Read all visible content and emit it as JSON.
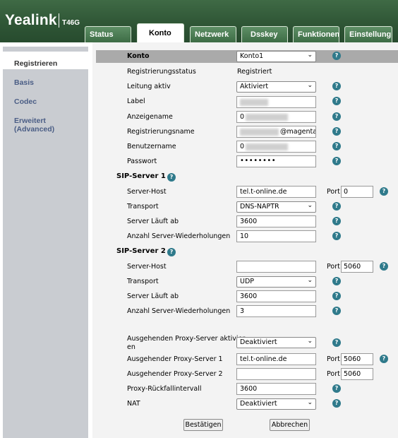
{
  "brand": {
    "logo": "Yealink",
    "model": "T46G"
  },
  "tabs": [
    {
      "label": "Status"
    },
    {
      "label": "Konto"
    },
    {
      "label": "Netzwerk"
    },
    {
      "label": "Dsskey"
    },
    {
      "label": "Funktionen"
    },
    {
      "label": "Einstellung"
    }
  ],
  "sidebar": {
    "items": [
      {
        "label": "Registrieren"
      },
      {
        "label": "Basis"
      },
      {
        "label": "Codec"
      },
      {
        "label": "Erweitert"
      },
      {
        "label": "(Advanced)"
      }
    ]
  },
  "account": {
    "header_label": "Konto",
    "header_value": "Konto1",
    "reg_status_label": "Registrierungsstatus",
    "reg_status_value": "Registriert",
    "line_active_label": "Leitung aktiv",
    "line_active_value": "Aktiviert",
    "label_label": "Label",
    "display_name_label": "Anzeigename",
    "display_name_value": "0",
    "register_name_label": "Registrierungsname",
    "register_name_value": "@magenta",
    "username_label": "Benutzername",
    "username_value": "0",
    "password_label": "Passwort",
    "password_value": "••••••••"
  },
  "sip1": {
    "title": "SIP-Server 1",
    "host_label": "Server-Host",
    "host_value": "tel.t-online.de",
    "port_label": "Port",
    "port_value": "0",
    "transport_label": "Transport",
    "transport_value": "DNS-NAPTR",
    "expires_label": "Server Läuft ab",
    "expires_value": "3600",
    "retry_label": "Anzahl Server-Wiederholungen",
    "retry_value": "10"
  },
  "sip2": {
    "title": "SIP-Server 2",
    "host_label": "Server-Host",
    "host_value": "",
    "port_label": "Port",
    "port_value": "5060",
    "transport_label": "Transport",
    "transport_value": "UDP",
    "expires_label": "Server Läuft ab",
    "expires_value": "3600",
    "retry_label": "Anzahl Server-Wiederholungen",
    "retry_value": "3"
  },
  "proxy": {
    "enable_label_line1": "Ausgehenden Proxy-Server aktivier",
    "enable_label_line2": "en",
    "enable_value": "Deaktiviert",
    "proxy1_label": "Ausgehender Proxy-Server 1",
    "proxy1_value": "tel.t-online.de",
    "proxy1_port_label": "Port",
    "proxy1_port": "5060",
    "proxy2_label": "Ausgehender Proxy-Server 2",
    "proxy2_value": "",
    "proxy2_port_label": "Port",
    "proxy2_port": "5060",
    "fallback_label": "Proxy-Rückfallintervall",
    "fallback_value": "3600",
    "nat_label": "NAT",
    "nat_value": "Deaktiviert"
  },
  "buttons": {
    "confirm": "Bestätigen",
    "cancel": "Abbrechen"
  },
  "help_glyph": "?",
  "chevron_glyph": "⌄",
  "colors": {
    "header_green": "#2f5636",
    "help_teal": "#2f7a8b",
    "sidebar_link": "#4a5d85",
    "sidebar_bg": "#c9ccd1"
  }
}
